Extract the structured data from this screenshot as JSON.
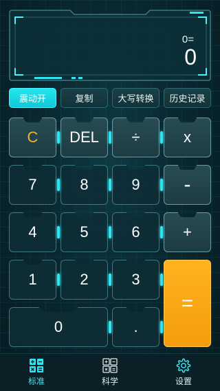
{
  "display": {
    "expression": "0=",
    "result": "0"
  },
  "function_row": [
    {
      "label": "震动开",
      "active": true
    },
    {
      "label": "复制",
      "active": false
    },
    {
      "label": "大写转换",
      "active": false
    },
    {
      "label": "历史记录",
      "active": false
    }
  ],
  "keys": {
    "clear": "C",
    "delete": "DEL",
    "divide": "÷",
    "multiply": "x",
    "seven": "7",
    "eight": "8",
    "nine": "9",
    "minus": "-",
    "four": "4",
    "five": "5",
    "six": "6",
    "plus": "+",
    "one": "1",
    "two": "2",
    "three": "3",
    "equals": "=",
    "zero": "0",
    "dot": "."
  },
  "tabs": [
    {
      "label": "标准",
      "icon": "grid-calculator-icon",
      "active": true
    },
    {
      "label": "科学",
      "icon": "scientific-calculator-icon",
      "active": false
    },
    {
      "label": "设置",
      "icon": "gear-icon",
      "active": false
    }
  ],
  "colors": {
    "accent": "#2ee6f3",
    "equals_key": "#f7a614",
    "clear_label": "#f0b42b"
  }
}
